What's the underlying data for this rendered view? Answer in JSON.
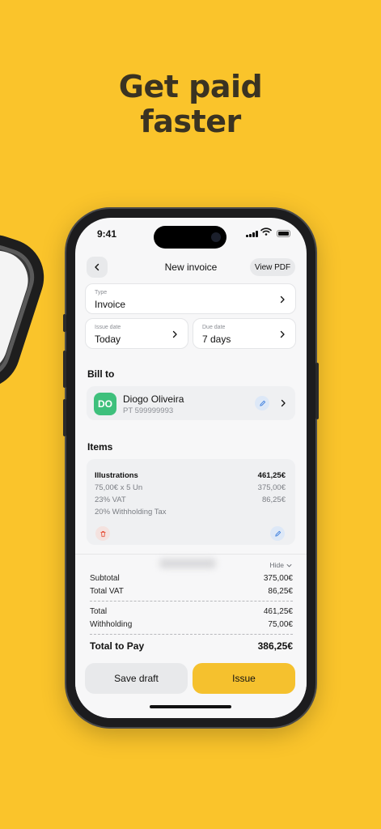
{
  "headline": {
    "line1": "Get paid",
    "line2": "faster"
  },
  "status_bar": {
    "time": "9:41"
  },
  "nav": {
    "title": "New invoice",
    "view_pdf": "View PDF"
  },
  "type_field": {
    "label": "Type",
    "value": "Invoice"
  },
  "issue_date": {
    "label": "Issue date",
    "value": "Today"
  },
  "due_date": {
    "label": "Due date",
    "value": "7 days"
  },
  "bill_to": {
    "section_title": "Bill to",
    "initials": "DO",
    "name": "Diogo Oliveira",
    "tax_id": "PT 599999993"
  },
  "items": {
    "section_title": "Items",
    "list": [
      {
        "name": "Illustrations",
        "total": "461,25€",
        "qty_line": "75,00€ x 5 Un",
        "qty_total": "375,00€",
        "vat_line": "23% VAT",
        "vat_total": "86,25€",
        "withholding_line": "20%  Withholding Tax"
      }
    ]
  },
  "summary": {
    "hide_label": "Hide",
    "subtotal_label": "Subtotal",
    "subtotal_value": "375,00€",
    "vat_label": "Total VAT",
    "vat_value": "86,25€",
    "total_label": "Total",
    "total_value": "461,25€",
    "withholding_label": "Withholding",
    "withholding_value": "75,00€",
    "to_pay_label": "Total to Pay",
    "to_pay_value": "386,25€"
  },
  "actions": {
    "save_draft": "Save draft",
    "issue": "Issue"
  },
  "colors": {
    "background": "#FAC42B",
    "accent_button": "#F5C12E",
    "avatar": "#3EC07C",
    "delete": "#E5533D",
    "edit": "#3B7DDD"
  }
}
